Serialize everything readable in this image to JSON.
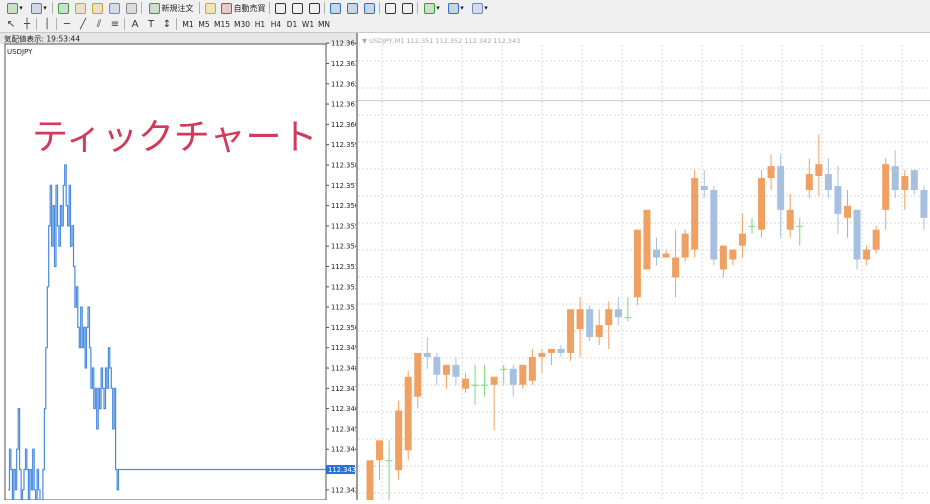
{
  "toolbar": {
    "row1": [
      {
        "name": "new-chart-icon",
        "color": "#3a9a3a",
        "dd": true
      },
      {
        "name": "profiles-icon",
        "color": "#4a7ec8",
        "dd": true
      },
      {
        "name": "market-watch-icon",
        "color": "#3a9a3a"
      },
      {
        "name": "navigator-icon",
        "color": "#d4a020"
      },
      {
        "name": "data-window-icon",
        "color": "#c8a030"
      },
      {
        "name": "terminal-icon",
        "color": "#6a8ab8"
      },
      {
        "name": "strategy-tester-icon",
        "color": "#8a8a8a"
      }
    ],
    "new_order_label": "新規注文",
    "autotrade_label": "自動売買",
    "row1_right": [
      {
        "name": "bar-chart-icon",
        "color": "#333"
      },
      {
        "name": "candlestick-icon",
        "color": "#333"
      },
      {
        "name": "line-chart-icon",
        "color": "#333"
      },
      {
        "name": "zoom-in-icon",
        "color": "#2a70c8"
      },
      {
        "name": "zoom-out-icon",
        "color": "#2a70c8"
      },
      {
        "name": "tile-windows-icon",
        "color": "#2a70c8"
      },
      {
        "name": "chart-shift-icon",
        "color": "#333"
      },
      {
        "name": "autoscroll-icon",
        "color": "#333"
      },
      {
        "name": "indicators-icon",
        "color": "#3a9a3a",
        "dd": true
      },
      {
        "name": "periods-icon",
        "color": "#2a70c8",
        "dd": true
      },
      {
        "name": "templates-icon",
        "color": "#6a8ab8",
        "dd": true
      }
    ],
    "row2_tools": [
      {
        "name": "cursor-icon",
        "glyph": "↖"
      },
      {
        "name": "crosshair-icon",
        "glyph": "┼"
      },
      {
        "name": "vertical-line-icon",
        "glyph": "│"
      },
      {
        "name": "horizontal-line-icon",
        "glyph": "─"
      },
      {
        "name": "trendline-icon",
        "glyph": "╱"
      },
      {
        "name": "equidistant-channel-icon",
        "glyph": "⫽"
      },
      {
        "name": "fibonacci-icon",
        "glyph": "≡"
      },
      {
        "name": "text-icon",
        "glyph": "A"
      },
      {
        "name": "text-label-icon",
        "glyph": "T"
      },
      {
        "name": "arrows-icon",
        "glyph": "↕"
      }
    ],
    "timeframes": [
      "M1",
      "M5",
      "M15",
      "M30",
      "H1",
      "H4",
      "D1",
      "W1",
      "MN"
    ]
  },
  "tick_chart": {
    "header": "気配値表示: 19:53:44",
    "symbol": "USDJPY",
    "title_overlay": "ティックチャート",
    "current_price": "112.343",
    "line_color": "#4a8be0",
    "title_color": "#d23a5a",
    "chart_data": {
      "type": "line",
      "ylim": [
        112.3415,
        112.3645
      ],
      "yticks": [
        "112.364",
        "112.363",
        "112.362",
        "112.361",
        "112.360",
        "112.359",
        "112.358",
        "112.357",
        "112.356",
        "112.355",
        "112.354",
        "112.353",
        "112.352",
        "112.351",
        "112.350",
        "112.349",
        "112.348",
        "112.347",
        "112.346",
        "112.345",
        "112.344",
        "112.343",
        "112.342"
      ],
      "series": [
        {
          "values": [
            112.342,
            112.344,
            112.343,
            112.341,
            112.343,
            112.342,
            112.344,
            112.346,
            112.343,
            112.341,
            112.342,
            112.343,
            112.344,
            112.343,
            112.341,
            112.343,
            112.342,
            112.344,
            112.342,
            112.341,
            112.343,
            112.342,
            112.341,
            112.3415,
            112.343,
            112.346,
            112.349,
            112.352,
            112.355,
            112.357,
            112.354,
            112.356,
            112.353,
            112.357,
            112.355,
            112.354,
            112.356,
            112.355,
            112.357,
            112.358,
            112.356,
            112.355,
            112.357,
            112.354,
            112.355,
            112.353,
            112.351,
            112.352,
            112.35,
            112.349,
            112.351,
            112.349,
            112.35,
            112.348,
            112.35,
            112.351,
            112.349,
            112.347,
            112.348,
            112.346,
            112.347,
            112.345,
            112.347,
            112.346,
            112.348,
            112.347,
            112.346,
            112.348,
            112.347,
            112.349,
            112.348,
            112.347,
            112.345,
            112.347,
            112.343,
            112.342,
            112.343,
            112.343
          ]
        }
      ]
    }
  },
  "candle_chart": {
    "header": "▼ USDJPY,M1  112.351 112.352 112.342 112.343",
    "up_color": "#f0a060",
    "down_color": "#a8c0e0",
    "doji_color": "#7ad87a",
    "chart_data": {
      "type": "candlestick",
      "ylim": [
        112.341,
        112.3645
      ],
      "level_line": 112.3611,
      "candles": [
        {
          "o": 112.341,
          "h": 112.343,
          "l": 112.341,
          "c": 112.343
        },
        {
          "o": 112.343,
          "h": 112.344,
          "l": 112.342,
          "c": 112.344
        },
        {
          "o": 112.343,
          "h": 112.344,
          "l": 112.341,
          "c": 112.343
        },
        {
          "o": 112.3425,
          "h": 112.346,
          "l": 112.342,
          "c": 112.3455
        },
        {
          "o": 112.3435,
          "h": 112.3475,
          "l": 112.343,
          "c": 112.3472
        },
        {
          "o": 112.3462,
          "h": 112.3484,
          "l": 112.3456,
          "c": 112.3484
        },
        {
          "o": 112.3484,
          "h": 112.3492,
          "l": 112.3476,
          "c": 112.3482
        },
        {
          "o": 112.3482,
          "h": 112.3484,
          "l": 112.3468,
          "c": 112.3473
        },
        {
          "o": 112.3473,
          "h": 112.3478,
          "l": 112.3466,
          "c": 112.3478
        },
        {
          "o": 112.3478,
          "h": 112.3482,
          "l": 112.3468,
          "c": 112.3472
        },
        {
          "o": 112.3466,
          "h": 112.3474,
          "l": 112.3464,
          "c": 112.3471
        },
        {
          "o": 112.3468,
          "h": 112.3478,
          "l": 112.3458,
          "c": 112.3468
        },
        {
          "o": 112.3468,
          "h": 112.3478,
          "l": 112.3462,
          "c": 112.3468
        },
        {
          "o": 112.3468,
          "h": 112.3472,
          "l": 112.3445,
          "c": 112.3472
        },
        {
          "o": 112.3476,
          "h": 112.3478,
          "l": 112.3468,
          "c": 112.3476
        },
        {
          "o": 112.3476,
          "h": 112.3478,
          "l": 112.3462,
          "c": 112.3468
        },
        {
          "o": 112.3468,
          "h": 112.3478,
          "l": 112.3466,
          "c": 112.3478
        },
        {
          "o": 112.347,
          "h": 112.3486,
          "l": 112.3468,
          "c": 112.3482
        },
        {
          "o": 112.3482,
          "h": 112.3486,
          "l": 112.3474,
          "c": 112.3484
        },
        {
          "o": 112.3484,
          "h": 112.3486,
          "l": 112.3478,
          "c": 112.3486
        },
        {
          "o": 112.3486,
          "h": 112.3488,
          "l": 112.3482,
          "c": 112.3484
        },
        {
          "o": 112.3484,
          "h": 112.3506,
          "l": 112.348,
          "c": 112.3506
        },
        {
          "o": 112.3496,
          "h": 112.3512,
          "l": 112.3482,
          "c": 112.3506
        },
        {
          "o": 112.3506,
          "h": 112.3508,
          "l": 112.349,
          "c": 112.3492
        },
        {
          "o": 112.3492,
          "h": 112.3506,
          "l": 112.3488,
          "c": 112.3498
        },
        {
          "o": 112.3498,
          "h": 112.351,
          "l": 112.3486,
          "c": 112.3506
        },
        {
          "o": 112.3506,
          "h": 112.3512,
          "l": 112.3498,
          "c": 112.3502
        },
        {
          "o": 112.3502,
          "h": 112.3512,
          "l": 112.35,
          "c": 112.3502
        },
        {
          "o": 112.3512,
          "h": 112.3546,
          "l": 112.3508,
          "c": 112.3546
        },
        {
          "o": 112.3526,
          "h": 112.3556,
          "l": 112.3526,
          "c": 112.3556
        },
        {
          "o": 112.3536,
          "h": 112.3542,
          "l": 112.3528,
          "c": 112.3532
        },
        {
          "o": 112.3532,
          "h": 112.3536,
          "l": 112.3532,
          "c": 112.3534
        },
        {
          "o": 112.3522,
          "h": 112.3546,
          "l": 112.3512,
          "c": 112.3532
        },
        {
          "o": 112.3532,
          "h": 112.3546,
          "l": 112.353,
          "c": 112.3544
        },
        {
          "o": 112.3536,
          "h": 112.3576,
          "l": 112.3532,
          "c": 112.3572
        },
        {
          "o": 112.3568,
          "h": 112.3576,
          "l": 112.3562,
          "c": 112.3566
        },
        {
          "o": 112.3566,
          "h": 112.3568,
          "l": 112.3528,
          "c": 112.3531
        },
        {
          "o": 112.3526,
          "h": 112.3538,
          "l": 112.3522,
          "c": 112.3538
        },
        {
          "o": 112.3531,
          "h": 112.3536,
          "l": 112.3528,
          "c": 112.3536
        },
        {
          "o": 112.3538,
          "h": 112.3554,
          "l": 112.3532,
          "c": 112.3544
        },
        {
          "o": 112.3548,
          "h": 112.3552,
          "l": 112.3544,
          "c": 112.3548
        },
        {
          "o": 112.3546,
          "h": 112.3576,
          "l": 112.3542,
          "c": 112.3572
        },
        {
          "o": 112.3572,
          "h": 112.3584,
          "l": 112.3566,
          "c": 112.3578
        },
        {
          "o": 112.3578,
          "h": 112.3584,
          "l": 112.3542,
          "c": 112.3556
        },
        {
          "o": 112.3546,
          "h": 112.3564,
          "l": 112.3542,
          "c": 112.3556
        },
        {
          "o": 112.3548,
          "h": 112.3552,
          "l": 112.3538,
          "c": 112.3548
        },
        {
          "o": 112.3566,
          "h": 112.3582,
          "l": 112.3562,
          "c": 112.3574
        },
        {
          "o": 112.3573,
          "h": 112.3594,
          "l": 112.3563,
          "c": 112.3579
        },
        {
          "o": 112.3574,
          "h": 112.3582,
          "l": 112.3562,
          "c": 112.3566
        },
        {
          "o": 112.3568,
          "h": 112.3578,
          "l": 112.3544,
          "c": 112.3554
        },
        {
          "o": 112.3552,
          "h": 112.3566,
          "l": 112.3542,
          "c": 112.3558
        },
        {
          "o": 112.3556,
          "h": 112.3556,
          "l": 112.3526,
          "c": 112.3531
        },
        {
          "o": 112.3531,
          "h": 112.3538,
          "l": 112.3528,
          "c": 112.3536
        },
        {
          "o": 112.3536,
          "h": 112.3548,
          "l": 112.3534,
          "c": 112.3546
        },
        {
          "o": 112.3556,
          "h": 112.3582,
          "l": 112.3546,
          "c": 112.3579
        },
        {
          "o": 112.3578,
          "h": 112.3586,
          "l": 112.3562,
          "c": 112.3566
        },
        {
          "o": 112.3566,
          "h": 112.3576,
          "l": 112.3556,
          "c": 112.3573
        },
        {
          "o": 112.3576,
          "h": 112.3576,
          "l": 112.3564,
          "c": 112.3566
        },
        {
          "o": 112.3566,
          "h": 112.3568,
          "l": 112.3546,
          "c": 112.3552
        },
        {
          "o": 112.3552,
          "h": 112.3556,
          "l": 112.3542,
          "c": 112.3546
        },
        {
          "o": 112.3548,
          "h": 112.3552,
          "l": 112.3542,
          "c": 112.3552
        }
      ]
    }
  }
}
